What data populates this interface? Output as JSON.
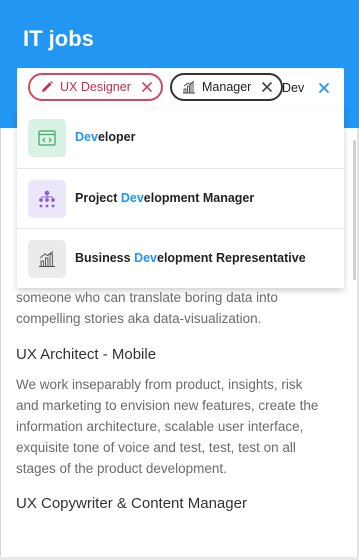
{
  "header": {
    "title": "IT jobs"
  },
  "search": {
    "chips": [
      {
        "label": "UX Designer",
        "icon": "pencil-icon",
        "color": "#c62f48"
      },
      {
        "label": "Manager",
        "icon": "bar-chart-icon",
        "color": "#222222"
      }
    ],
    "input_value": "Dev",
    "query_highlight": "Dev"
  },
  "dropdown": {
    "options": [
      {
        "pre": "",
        "match": "Dev",
        "post": "eloper",
        "icon": "code-window-icon",
        "icon_bg": "#d9f2e3",
        "icon_color": "#3aa66a"
      },
      {
        "pre": "Project ",
        "match": "Dev",
        "post": "elopment Manager",
        "icon": "org-chart-icon",
        "icon_bg": "#ece6fa",
        "icon_color": "#8a5cd8"
      },
      {
        "pre": "Business ",
        "match": "Dev",
        "post": "elopment Representative",
        "icon": "bar-chart-icon",
        "icon_bg": "#ebebeb",
        "icon_color": "#555555"
      }
    ]
  },
  "jobs": {
    "partial_description_line1": "someone who can translate boring data into",
    "partial_description_line2": "compelling stories aka data-visualization.",
    "items": [
      {
        "title": "UX Architect - Mobile",
        "description_lines": [
          "We work inseparably from product, insights, risk",
          "and marketing to envision new features, create the",
          "information architecture, scalable user interface,",
          "exquisite tone of voice and test, test, test on all",
          "stages of the product development."
        ]
      },
      {
        "title": "UX Copywriter & Content Manager"
      }
    ]
  },
  "colors": {
    "accent": "#2196f3",
    "chip_ux": "#c62f48",
    "highlight": "#2196f3"
  }
}
